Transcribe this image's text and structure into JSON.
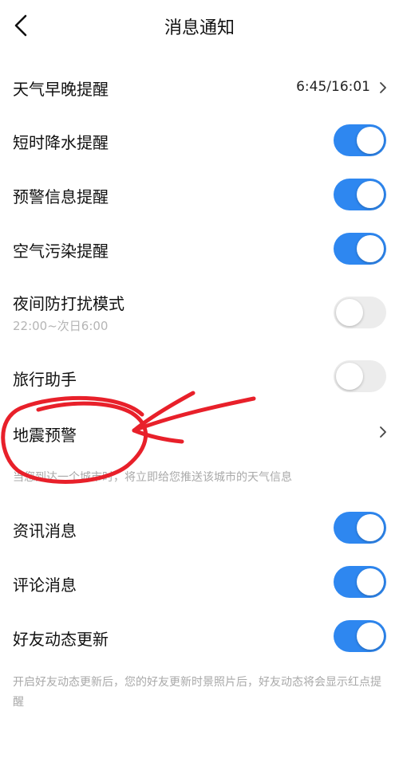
{
  "header": {
    "title": "消息通知"
  },
  "rows": {
    "weather_reminder": {
      "label": "天气早晚提醒",
      "value": "6:45/16:01"
    },
    "short_rain": {
      "label": "短时降水提醒",
      "enabled": true
    },
    "warning_info": {
      "label": "预警信息提醒",
      "enabled": true
    },
    "air_pollution": {
      "label": "空气污染提醒",
      "enabled": true
    },
    "night_dnd": {
      "label": "夜间防打扰模式",
      "sub": "22:00~次日6:00",
      "enabled": false
    },
    "travel_assistant": {
      "label": "旅行助手",
      "enabled": false
    },
    "earthquake": {
      "label": "地震预警"
    },
    "news": {
      "label": "资讯消息",
      "enabled": true
    },
    "comments": {
      "label": "评论消息",
      "enabled": true
    },
    "friend_updates": {
      "label": "好友动态更新",
      "enabled": true
    }
  },
  "notes": {
    "travel_note": "当您到达一个城市时，将立即给您推送该城市的天气信息",
    "friend_note": "开启好友动态更新后，您的好友更新时景照片后，好友动态将会显示红点提醒"
  },
  "colors": {
    "toggle_on": "#2e87f0",
    "toggle_off": "#ececec",
    "annotation": "#e8202a"
  }
}
